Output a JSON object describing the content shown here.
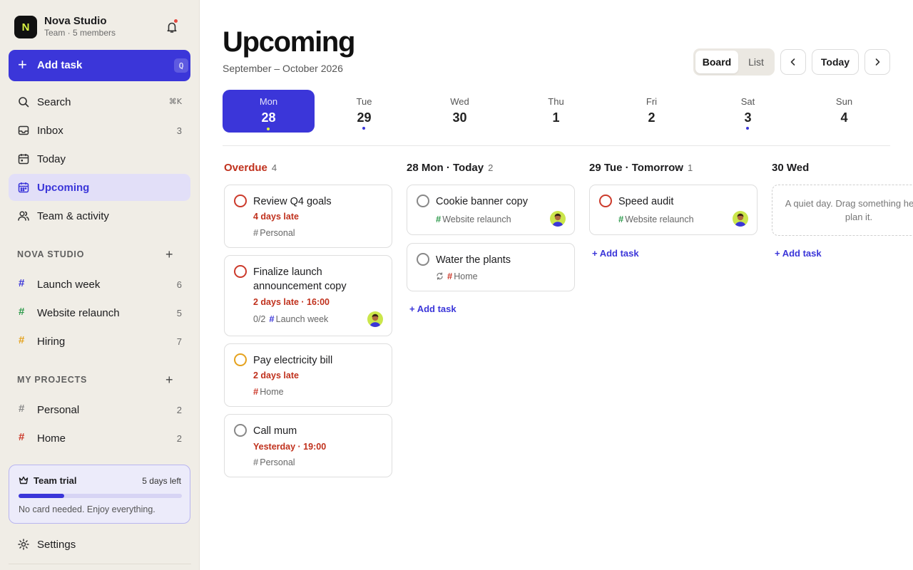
{
  "workspace": {
    "logo_letter": "N",
    "name": "Nova Studio",
    "subtitle": "Team · 5 members"
  },
  "add_task": {
    "label": "Add task",
    "shortcut": "Q"
  },
  "nav": [
    {
      "label": "Search",
      "shortcut": "⌘K",
      "icon": "search-icon"
    },
    {
      "label": "Inbox",
      "count": "3",
      "icon": "inbox-icon"
    },
    {
      "label": "Today",
      "icon": "calendar-icon"
    },
    {
      "label": "Upcoming",
      "icon": "calendar-grid-icon",
      "active": true
    },
    {
      "label": "Team & activity",
      "icon": "team-icon"
    }
  ],
  "team_section": {
    "title": "NOVA STUDIO",
    "projects": [
      {
        "name": "Launch week",
        "count": "6",
        "color": "#3b36d9"
      },
      {
        "name": "Website relaunch",
        "count": "5",
        "color": "#2e9a4c"
      },
      {
        "name": "Hiring",
        "count": "7",
        "color": "#e5a21e"
      }
    ]
  },
  "my_section": {
    "title": "MY PROJECTS",
    "projects": [
      {
        "name": "Personal",
        "count": "2",
        "color": "#8a8a8a"
      },
      {
        "name": "Home",
        "count": "2",
        "color": "#cc3a2b"
      }
    ]
  },
  "trial": {
    "title": "Team trial",
    "days_left": "5 days left",
    "note": "No card needed. Enjoy everything.",
    "progress": 0.28
  },
  "settings_label": "Settings",
  "main": {
    "title": "Upcoming",
    "subtitle": "September – October 2026",
    "view_toggle": {
      "board": "Board",
      "list": "List",
      "selected": "Board"
    },
    "today_button": "Today"
  },
  "week": [
    {
      "dow": "Mon",
      "num": "28",
      "selected": true,
      "dot": true
    },
    {
      "dow": "Tue",
      "num": "29",
      "dot": true
    },
    {
      "dow": "Wed",
      "num": "30"
    },
    {
      "dow": "Thu",
      "num": "1"
    },
    {
      "dow": "Fri",
      "num": "2"
    },
    {
      "dow": "Sat",
      "num": "3",
      "dot": true
    },
    {
      "dow": "Sun",
      "num": "4"
    }
  ],
  "columns": {
    "overdue": {
      "title": "Overdue",
      "count": "4",
      "tasks": [
        {
          "title": "Review Q4 goals",
          "late": "4 days late",
          "project": "Personal",
          "project_color": "#8a8a8a",
          "priority": "red"
        },
        {
          "title": "Finalize launch announcement copy",
          "late": "2 days late · 16:00",
          "subtasks": "0/2",
          "project": "Launch week",
          "project_color": "#3b36d9",
          "priority": "red",
          "assignee": true
        },
        {
          "title": "Pay electricity bill",
          "late": "2 days late",
          "project": "Home",
          "project_color": "#cc3a2b",
          "priority": "amber"
        },
        {
          "title": "Call mum",
          "late": "Yesterday · 19:00",
          "project": "Personal",
          "project_color": "#8a8a8a",
          "priority": "none"
        }
      ]
    },
    "today": {
      "title": "28 Mon · Today",
      "count": "2",
      "tasks": [
        {
          "title": "Cookie banner copy",
          "project": "Website relaunch",
          "project_color": "#2e9a4c",
          "priority": "none",
          "assignee": true
        },
        {
          "title": "Water the plants",
          "project": "Home",
          "project_color": "#cc3a2b",
          "priority": "none",
          "recurring": true
        }
      ],
      "add_label": "+ Add task"
    },
    "tomorrow": {
      "title": "29 Tue · Tomorrow",
      "count": "1",
      "tasks": [
        {
          "title": "Speed audit",
          "project": "Website relaunch",
          "project_color": "#2e9a4c",
          "priority": "red",
          "assignee": true
        }
      ],
      "add_label": "+ Add task"
    },
    "wed": {
      "title": "30 Wed",
      "empty_text": "A quiet day. Drag something here to plan it.",
      "add_label": "+ Add task"
    }
  },
  "colors": {
    "accent": "#3b36d9",
    "overdue": "#c0311d",
    "lime": "#d9f542"
  }
}
